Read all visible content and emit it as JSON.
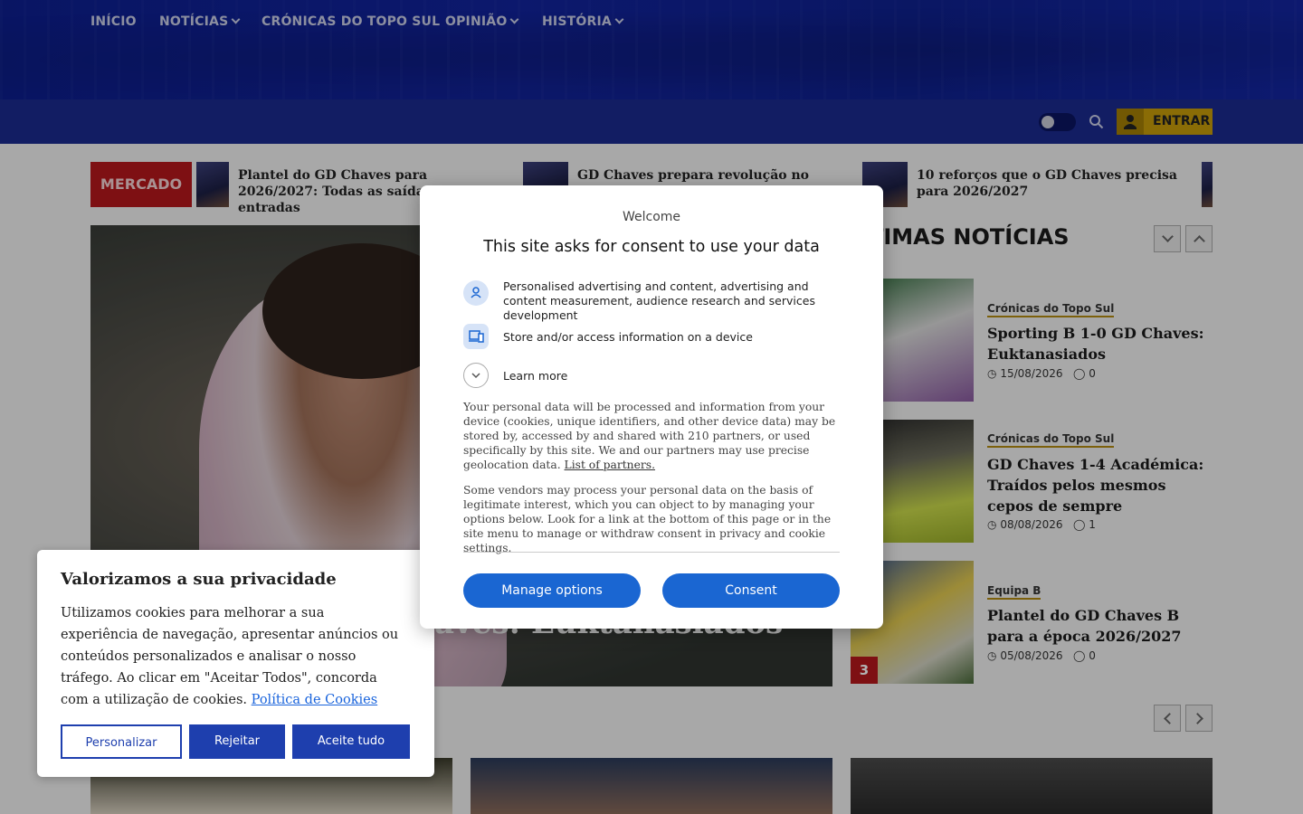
{
  "nav": {
    "items": [
      {
        "label": "INÍCIO",
        "dropdown": false
      },
      {
        "label": "NOTÍCIAS",
        "dropdown": true
      },
      {
        "label": "CRÓNICAS DO TOPO SUL",
        "dropdown": false
      },
      {
        "label": "OPINIÃO",
        "dropdown": true
      },
      {
        "label": "HISTÓRIA",
        "dropdown": true
      }
    ],
    "login_label": "ENTRAR",
    "accent_color": "#c69b0a",
    "bar_color": "#1a2a8e"
  },
  "ticker": {
    "badge": "MERCADO",
    "items": [
      "Plantel do GD Chaves para 2026/2027: Todas as saídas e entradas",
      "GD Chaves prepara revolução no",
      "10 reforços que o GD Chaves precisa para 2026/2027"
    ]
  },
  "hero": {
    "title_fragment": "aves: Euktanasiados"
  },
  "latest": {
    "title": "TIMAS NOTÍCIAS",
    "items": [
      {
        "category": "Crónicas do Topo Sul",
        "title": "Sporting B 1-0 GD Chaves: Euktanasiados",
        "date": "15/08/2026",
        "comments": "0"
      },
      {
        "category": "Crónicas do Topo Sul",
        "title": "GD Chaves 1-4 Académica: Traídos pelos mesmos cepos de sempre",
        "date": "08/08/2026",
        "comments": "1"
      },
      {
        "category": "Equipa B",
        "title": "Plantel do GD Chaves B para a época 2026/2027",
        "date": "05/08/2026",
        "comments": "0"
      }
    ],
    "badge_number": "3"
  },
  "cookie_banner": {
    "title": "Valorizamos a sua privacidade",
    "body": "Utilizamos cookies para melhorar a sua experiência de navegação, apresentar anúncios ou conteúdos personalizados e analisar o nosso tráfego. Ao clicar em \"Aceitar Todos\", concorda com a utilização de cookies.",
    "link": "Política de Cookies",
    "customize": "Personalizar",
    "reject": "Rejeitar",
    "accept": "Aceite tudo"
  },
  "consent_modal": {
    "welcome": "Welcome",
    "title": "This site asks for consent to use your data",
    "purposes": [
      "Personalised advertising and content, advertising and content measurement, audience research and services development",
      "Store and/or access information on a device"
    ],
    "learn_more": "Learn more",
    "para1": "Your personal data will be processed and information from your device (cookies, unique identifiers, and other device data) may be stored by, accessed by and shared with 210 partners, or used specifically by this site. We and our partners may use precise geolocation data.",
    "partners_link": "List of partners.",
    "para2": "Some vendors may process your personal data on the basis of legitimate interest, which you can object to by managing your options below. Look for a link at the bottom of this page or in the site menu to manage or withdraw consent in privacy and cookie settings.",
    "manage": "Manage options",
    "consent": "Consent"
  }
}
